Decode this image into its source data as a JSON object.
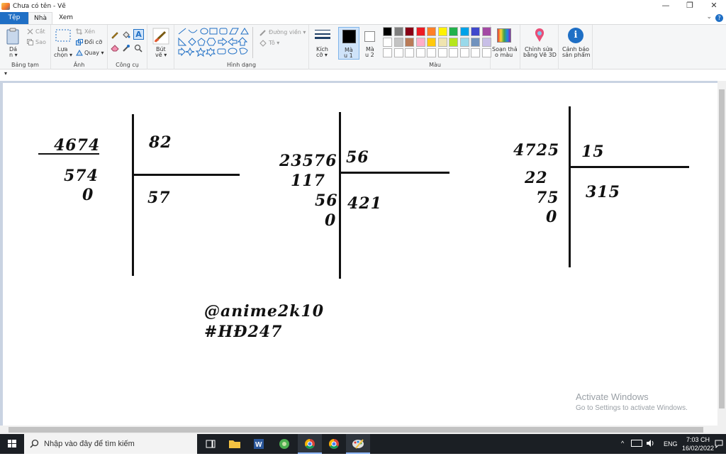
{
  "window": {
    "title": "Chưa có tên - Vẽ",
    "minimize_glyph": "—",
    "maximize_glyph": "❐",
    "close_glyph": "✕"
  },
  "tabs": {
    "file": "Tệp",
    "home": "Nhà",
    "view": "Xem",
    "collapse_glyph": "⌄",
    "help_glyph": "?"
  },
  "ribbon": {
    "clipboard": {
      "paste": "Dá",
      "paste_more": "n ▾",
      "cut": "Cắt",
      "copy": "Sao",
      "label": "Bảng tạm"
    },
    "image": {
      "select": "Lựa",
      "select_more": "chọn ▾",
      "crop": "Xén",
      "resize": "Đổi cỡ",
      "rotate": "Quay ▾",
      "label": "Ảnh"
    },
    "tools": {
      "label": "Công cụ"
    },
    "brushes": {
      "label": "Bút",
      "label_more": "vẽ ▾"
    },
    "shapes": {
      "outline": "Đường viền ▾",
      "fill": "Tô ▾",
      "label": "Hình dạng"
    },
    "size": {
      "label": "Kích",
      "label_more": "cỡ ▾"
    },
    "color1": {
      "label": "Mà",
      "label_more": "u 1"
    },
    "color2": {
      "label": "Mà",
      "label_more": "u 2"
    },
    "colors": {
      "label": "Màu",
      "palette_row1": [
        "#000000",
        "#7f7f7f",
        "#880015",
        "#ed1c24",
        "#ff7f27",
        "#fff200",
        "#22b14c",
        "#00a2e8",
        "#3f48cc",
        "#a349a4"
      ],
      "palette_row2": [
        "#ffffff",
        "#c3c3c3",
        "#b97a57",
        "#ffaec9",
        "#ffc90e",
        "#efe4b0",
        "#b5e61d",
        "#99d9ea",
        "#7092be",
        "#c8bfe7"
      ],
      "palette_row3_count": 10,
      "color1_value": "#000000",
      "color2_value": "#ffffff"
    },
    "edit_colors": {
      "line1": "Soạn thả",
      "line2": "o màu"
    },
    "paint3d": {
      "line1": "Chỉnh sửa",
      "line2": "bằng Vẽ 3D"
    },
    "product_alert": {
      "line1": "Cảnh báo",
      "line2": "sản phẩm"
    }
  },
  "qat": {
    "glyph": "▾"
  },
  "canvas": {
    "div1": {
      "dividend": "4674",
      "divisor": "82",
      "step1": "574",
      "step2": "0",
      "quotient": "57"
    },
    "div2": {
      "dividend": "23576",
      "divisor": "56",
      "step1": "117",
      "step2": "56",
      "step3": "0",
      "quotient": "421"
    },
    "div3": {
      "dividend": "4725",
      "divisor": "15",
      "step1": "22",
      "step2": "75",
      "step3": "0",
      "quotient": "315"
    },
    "credit1": "@anime2k10",
    "credit2": "#HĐ247"
  },
  "watermark": {
    "line1": "Activate Windows",
    "line2": "Go to Settings to activate Windows."
  },
  "taskbar": {
    "search_placeholder": "Nhập vào đây để tìm kiếm",
    "lang": "ENG",
    "time": "7:03 CH",
    "date": "16/02/2022",
    "tray_chevron": "^"
  }
}
